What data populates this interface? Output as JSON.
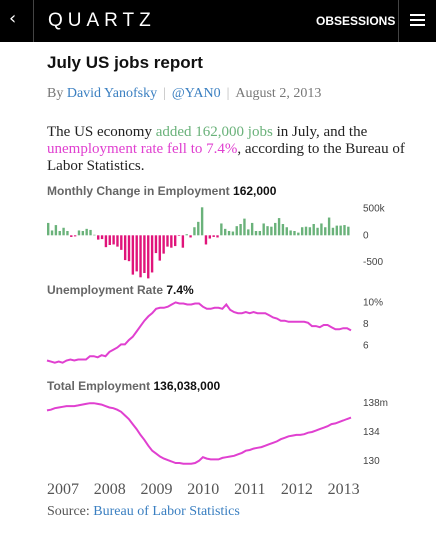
{
  "nav": {
    "back_icon": "‹",
    "brand": "QUARTZ",
    "obsessions": "OBSESSIONS",
    "menu_icon": "hamburger-menu-icon"
  },
  "article": {
    "title": "July US jobs report",
    "by": "By",
    "author": "David Yanofsky",
    "handle": "@YAN0",
    "date": "August 2, 2013",
    "lede": {
      "p1": "The US economy ",
      "h1": "added 162,000 jobs",
      "p2": " in July, and the ",
      "h2": "unemployment rate fell to 7.4%",
      "p3": ", according to the Bureau of Labor Statistics."
    },
    "source_label": "Source:",
    "source_link": "Bureau of Labor Statistics"
  },
  "colors": {
    "positive": "#6ab27a",
    "negative": "#e0147a",
    "line": "#e040d0",
    "link": "#3a7fc1"
  },
  "chart_data": [
    {
      "type": "bar",
      "title": "Monthly Change in Employment",
      "title_value": "162,000",
      "yticks": [
        "500k",
        "0",
        "-500"
      ],
      "ylim": [
        -700,
        600
      ],
      "x": [
        "2007-01",
        "2007-02",
        "2007-03",
        "2007-04",
        "2007-05",
        "2007-06",
        "2007-07",
        "2007-08",
        "2007-09",
        "2007-10",
        "2007-11",
        "2007-12",
        "2008-01",
        "2008-02",
        "2008-03",
        "2008-04",
        "2008-05",
        "2008-06",
        "2008-07",
        "2008-08",
        "2008-09",
        "2008-10",
        "2008-11",
        "2008-12",
        "2009-01",
        "2009-02",
        "2009-03",
        "2009-04",
        "2009-05",
        "2009-06",
        "2009-07",
        "2009-08",
        "2009-09",
        "2009-10",
        "2009-11",
        "2009-12",
        "2010-01",
        "2010-02",
        "2010-03",
        "2010-04",
        "2010-05",
        "2010-06",
        "2010-07",
        "2010-08",
        "2010-09",
        "2010-10",
        "2010-11",
        "2010-12",
        "2011-01",
        "2011-02",
        "2011-03",
        "2011-04",
        "2011-05",
        "2011-06",
        "2011-07",
        "2011-08",
        "2011-09",
        "2011-10",
        "2011-11",
        "2011-12",
        "2012-01",
        "2012-02",
        "2012-03",
        "2012-04",
        "2012-05",
        "2012-06",
        "2012-07",
        "2012-08",
        "2012-09",
        "2012-10",
        "2012-11",
        "2012-12",
        "2013-01",
        "2013-02",
        "2013-03",
        "2013-04",
        "2013-05",
        "2013-06",
        "2013-07"
      ],
      "values": [
        230,
        90,
        190,
        80,
        140,
        80,
        -30,
        -20,
        90,
        80,
        120,
        100,
        10,
        -80,
        -70,
        -220,
        -180,
        -170,
        -210,
        -270,
        -460,
        -480,
        -730,
        -670,
        -780,
        -700,
        -800,
        -690,
        -330,
        -470,
        -340,
        -210,
        -230,
        -200,
        -10,
        -230,
        20,
        -40,
        150,
        250,
        520,
        -170,
        -60,
        -30,
        -40,
        220,
        120,
        80,
        70,
        170,
        210,
        310,
        110,
        230,
        80,
        80,
        220,
        170,
        160,
        230,
        320,
        210,
        150,
        90,
        80,
        50,
        150,
        160,
        150,
        210,
        140,
        220,
        150,
        330,
        140,
        180,
        180,
        190,
        160
      ]
    },
    {
      "type": "line",
      "title": "Unemployment Rate",
      "title_value": "7.4%",
      "yticks": [
        "10%",
        "8",
        "6"
      ],
      "ylim": [
        4,
        10.5
      ],
      "x_start": "2007-01",
      "values": [
        4.6,
        4.5,
        4.4,
        4.5,
        4.4,
        4.6,
        4.7,
        4.6,
        4.7,
        4.7,
        4.7,
        5.0,
        5.0,
        4.9,
        5.1,
        5.0,
        5.4,
        5.6,
        5.8,
        6.1,
        6.1,
        6.5,
        6.8,
        7.3,
        7.8,
        8.3,
        8.7,
        9.0,
        9.4,
        9.5,
        9.5,
        9.6,
        9.8,
        10.0,
        9.9,
        9.9,
        9.8,
        9.8,
        9.9,
        9.9,
        9.6,
        9.4,
        9.4,
        9.5,
        9.5,
        9.4,
        9.8,
        9.3,
        9.1,
        9.0,
        9.0,
        9.1,
        9.0,
        9.1,
        9.0,
        9.0,
        9.0,
        8.8,
        8.6,
        8.5,
        8.3,
        8.3,
        8.2,
        8.2,
        8.2,
        8.2,
        8.2,
        8.1,
        7.8,
        7.8,
        7.7,
        7.9,
        7.9,
        7.7,
        7.5,
        7.5,
        7.6,
        7.6,
        7.4
      ]
    },
    {
      "type": "line",
      "title": "Total Employment",
      "title_value": "136,038,000",
      "yticks": [
        "138m",
        "134",
        "130"
      ],
      "ylim": [
        129,
        139
      ],
      "x_start": "2007-01",
      "values": [
        137.0,
        137.1,
        137.3,
        137.4,
        137.5,
        137.6,
        137.6,
        137.6,
        137.7,
        137.8,
        137.9,
        138.0,
        138.0,
        137.9,
        137.8,
        137.6,
        137.4,
        137.3,
        137.1,
        136.8,
        136.3,
        135.8,
        135.1,
        134.4,
        133.6,
        132.9,
        132.1,
        131.4,
        131.0,
        130.6,
        130.3,
        130.1,
        129.9,
        129.7,
        129.7,
        129.6,
        129.6,
        129.6,
        129.7,
        130.0,
        130.5,
        130.3,
        130.2,
        130.2,
        130.2,
        130.4,
        130.5,
        130.6,
        130.7,
        130.9,
        131.1,
        131.4,
        131.5,
        131.7,
        131.8,
        131.9,
        132.1,
        132.3,
        132.5,
        132.7,
        133.0,
        133.2,
        133.4,
        133.5,
        133.6,
        133.6,
        133.7,
        133.9,
        134.0,
        134.2,
        134.4,
        134.6,
        134.8,
        135.1,
        135.2,
        135.4,
        135.6,
        135.8,
        136.0
      ]
    }
  ],
  "x_axis": {
    "years": [
      "2007",
      "2008",
      "2009",
      "2010",
      "2011",
      "2012",
      "2013"
    ]
  }
}
